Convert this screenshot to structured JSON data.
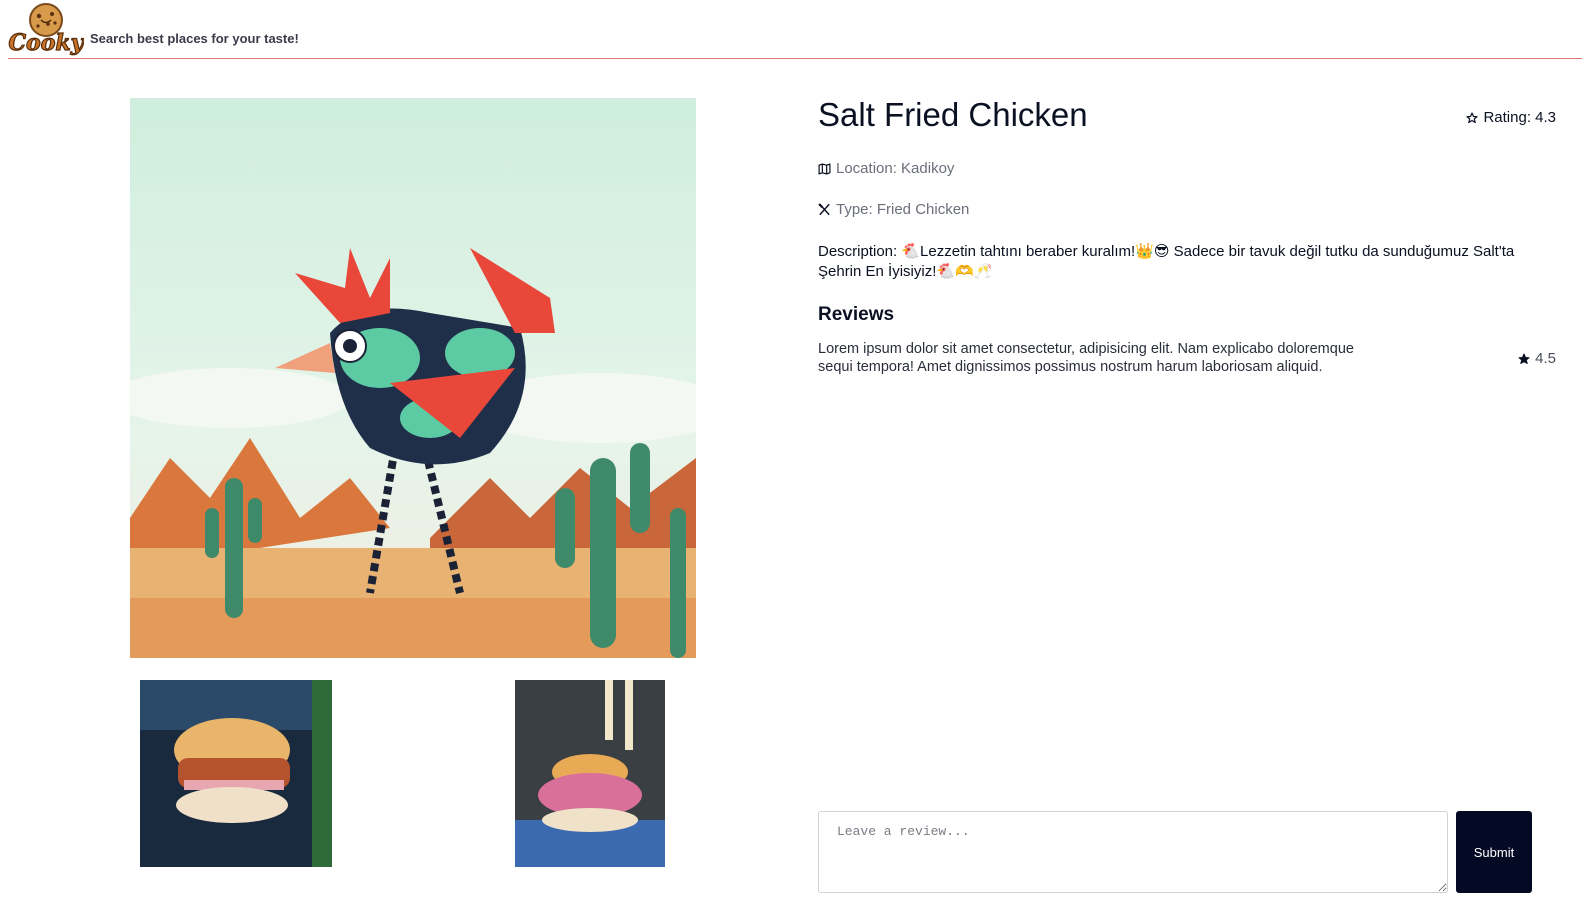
{
  "header": {
    "logo_text": "Cooky",
    "tagline": "Search best places for your taste!"
  },
  "place": {
    "name": "Salt Fried Chicken",
    "rating_label": "Rating: 4.3",
    "location_label": "Location: Kadikoy",
    "type_label": "Type: Fried Chicken",
    "description": "Description: 🐔Lezzetin tahtını beraber kuralım!👑😎 Sadece bir tavuk değil tutku da sunduğumuz Salt'ta Şehrin En İyisiyiz!🐔🫶🥂"
  },
  "reviews": {
    "heading": "Reviews",
    "items": [
      {
        "text": "Lorem ipsum dolor sit amet consectetur, adipisicing elit. Nam explicabo doloremque sequi tempora! Amet dignissimos possimus nostrum harum laboriosam aliquid.",
        "rating": "4.5"
      }
    ]
  },
  "review_form": {
    "placeholder": "Leave a review...",
    "value": "",
    "submit_label": "Submit"
  },
  "icons": {
    "rating": "star-icon",
    "location": "map-icon",
    "type": "utensils-icon",
    "review_rating": "star-icon"
  },
  "colors": {
    "accent": "#050a24",
    "header_line": "#e07a7a",
    "muted_text": "#6b6f7a"
  }
}
